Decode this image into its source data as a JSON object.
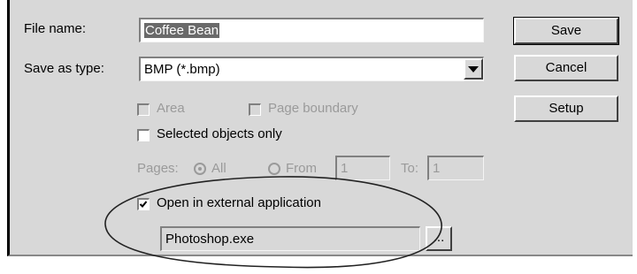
{
  "file_name": {
    "label": "File name:",
    "value": "Coffee Bean"
  },
  "save_as_type": {
    "label": "Save as type:",
    "value": "BMP (*.bmp)"
  },
  "buttons": {
    "save": "Save",
    "cancel": "Cancel",
    "setup": "Setup",
    "browse": "..."
  },
  "options": {
    "area": {
      "label": "Area",
      "checked": false,
      "enabled": false
    },
    "page_boundary": {
      "label": "Page boundary",
      "checked": false,
      "enabled": false
    },
    "selected_objects_only": {
      "label": "Selected objects only",
      "checked": false,
      "enabled": true
    }
  },
  "pages": {
    "label": "Pages:",
    "all_label": "All",
    "from_label": "From",
    "from_value": "1",
    "to_label": "To:",
    "to_value": "1",
    "enabled": false
  },
  "external": {
    "label": "Open in external application",
    "checked": true,
    "application": "Photoshop.exe"
  },
  "icons": {
    "dropdown": "chevron-down-icon",
    "checkmark": "checkmark-icon"
  }
}
